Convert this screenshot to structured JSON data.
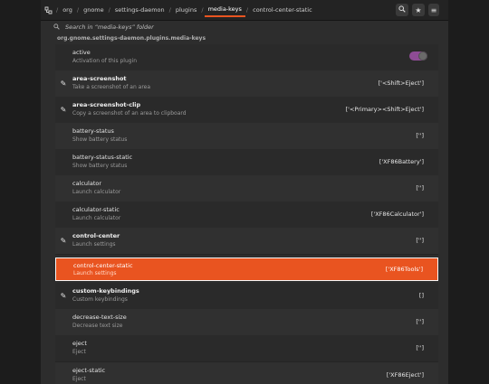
{
  "header": {
    "path": [
      "org",
      "gnome",
      "settings-daemon",
      "plugins",
      "media-keys",
      "control-center-static"
    ],
    "active_index": 4,
    "buttons": {
      "search": "search-icon",
      "bookmark": "star-icon",
      "menu": "hamburger-menu-icon",
      "close": "close-icon"
    }
  },
  "search": {
    "placeholder": "Search in “media-keys” folder"
  },
  "schema": {
    "id": "org.gnome.settings-daemon.plugins.media-keys"
  },
  "rows": [
    {
      "key": "active",
      "desc": "Activation of this plugin",
      "value": "",
      "modified": false,
      "selected": false,
      "toggle": true
    },
    {
      "key": "area-screenshot",
      "desc": "Take a screenshot of an area",
      "value": "['<Shift>Eject']",
      "modified": true,
      "selected": false
    },
    {
      "key": "area-screenshot-clip",
      "desc": "Copy a screenshot of an area to clipboard",
      "value": "['<Primary><Shift>Eject']",
      "modified": true,
      "selected": false
    },
    {
      "key": "battery-status",
      "desc": "Show battery status",
      "value": "['']",
      "modified": false,
      "selected": false
    },
    {
      "key": "battery-status-static",
      "desc": "Show battery status",
      "value": "['XF86Battery']",
      "modified": false,
      "selected": false
    },
    {
      "key": "calculator",
      "desc": "Launch calculator",
      "value": "['']",
      "modified": false,
      "selected": false
    },
    {
      "key": "calculator-static",
      "desc": "Launch calculator",
      "value": "['XF86Calculator']",
      "modified": false,
      "selected": false
    },
    {
      "key": "control-center",
      "desc": "Launch settings",
      "value": "['']",
      "modified": true,
      "selected": false
    },
    {
      "key": "control-center-static",
      "desc": "Launch settings",
      "value": "['XF86Tools']",
      "modified": false,
      "selected": true
    },
    {
      "key": "custom-keybindings",
      "desc": "Custom keybindings",
      "value": "[]",
      "modified": true,
      "selected": false
    },
    {
      "key": "decrease-text-size",
      "desc": "Decrease text size",
      "value": "['']",
      "modified": false,
      "selected": false
    },
    {
      "key": "eject",
      "desc": "Eject",
      "value": "['']",
      "modified": false,
      "selected": false
    },
    {
      "key": "eject-static",
      "desc": "Eject",
      "value": "['XF86Eject']",
      "modified": false,
      "selected": false
    }
  ],
  "colors": {
    "accent": "#e95420",
    "toggle_on": "#8e4c95",
    "background": "#2d2d2d"
  }
}
